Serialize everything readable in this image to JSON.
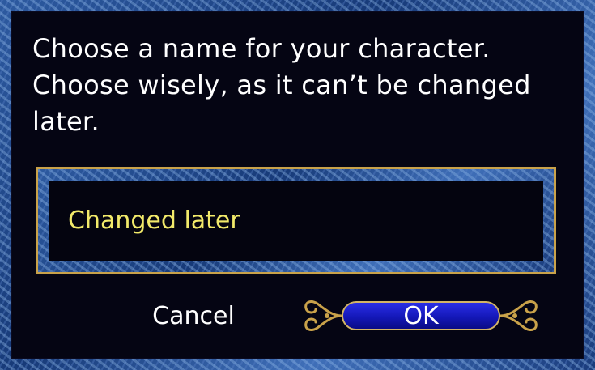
{
  "dialog": {
    "prompt_lines": [
      "Choose a name for your character.",
      "Choose wisely, as it can’t be changed",
      "later."
    ],
    "name_input_value": "Changed later",
    "cancel_label": "Cancel",
    "ok_label": "OK"
  },
  "colors": {
    "frame_blue": "#2d5aa0",
    "panel_background": "#050513",
    "input_text": "#f2ea6a",
    "gold_trim": "#c9a24a",
    "ok_button_fill": "#1418b8"
  },
  "icons": {
    "ok_ornament": "scroll-ornament-icon"
  }
}
